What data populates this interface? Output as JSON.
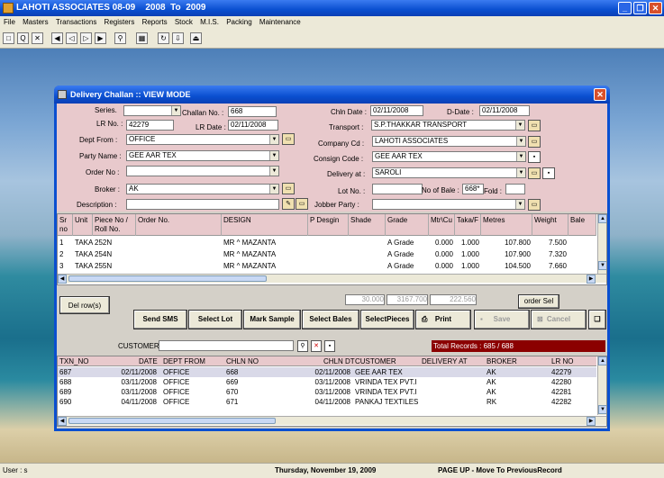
{
  "app": {
    "title": "LAHOTI ASSOCIATES 08-09    2008  To  2009"
  },
  "menu": [
    "File",
    "Masters",
    "Transactions",
    "Registers",
    "Reports",
    "Stock",
    "M.I.S.",
    "Packing",
    "Maintenance"
  ],
  "dialog": {
    "title": "Delivery Challan :: VIEW MODE"
  },
  "form": {
    "series_label": "Series.",
    "series_value": "",
    "challan_no_label": "Challan No. :",
    "challan_no": "668",
    "lr_no_label": "LR No. :",
    "lr_no": "42279",
    "lr_date_label": "LR Date :",
    "lr_date": "02/11/2008",
    "dept_from_label": "Dept From :",
    "dept_from": "OFFICE",
    "party_name_label": "Party Name :",
    "party_name": "GEE AAR TEX",
    "order_no_label": "Order No :",
    "order_no": "",
    "broker_label": "Broker :",
    "broker": "AK",
    "description_label": "Description :",
    "description": "",
    "chln_date_label": "Chln Date :",
    "chln_date": "02/11/2008",
    "d_date_label": "D-Date :",
    "d_date": "02/11/2008",
    "transport_label": "Transport :",
    "transport": "S.P.THAKKAR TRANSPORT",
    "company_cd_label": "Company Cd :",
    "company_cd": "LAHOTI ASSOCIATES",
    "consign_code_label": "Consign Code :",
    "consign_code": "GEE AAR TEX",
    "delivery_at_label": "Delivery at :",
    "delivery_at": "SAROLI",
    "lot_no_label": "Lot No. :",
    "lot_no": "",
    "no_of_bale_label": "No of Bale :",
    "no_of_bale": "668*",
    "fold_label": "Fold :",
    "fold": "",
    "jobber_party_label": "Jobber Party :",
    "jobber_party": ""
  },
  "items": {
    "columns": [
      "Sr no",
      "Unit",
      "Piece No / Roll No.",
      "Order No.",
      "DESIGN",
      "P Desgin",
      "Shade",
      "Grade",
      "Mtr\\Cu",
      "Taka/F",
      "Metres",
      "Weight",
      "Bale"
    ],
    "rows": [
      [
        "1",
        "TAKA",
        "252N",
        "",
        "MR ^ MAZANTA",
        "",
        "",
        "A Grade",
        "0.000",
        "1.000",
        "107.800",
        "7.500",
        ""
      ],
      [
        "2",
        "TAKA",
        "254N",
        "",
        "MR ^ MAZANTA",
        "",
        "",
        "A Grade",
        "0.000",
        "1.000",
        "107.900",
        "7.320",
        ""
      ],
      [
        "3",
        "TAKA",
        "255N",
        "",
        "MR ^ MAZANTA",
        "",
        "",
        "A Grade",
        "0.000",
        "1.000",
        "104.500",
        "7.660",
        ""
      ]
    ]
  },
  "totals": {
    "t1": "30.000",
    "t2": "3167.700",
    "t3": "222.560"
  },
  "buttons": {
    "del_row": "Del row(s)",
    "order_sel": "order Sel",
    "send_sms": "Send SMS",
    "select_lot": "Select Lot",
    "mark_sample": "Mark Sample",
    "select_bales": "Select Bales",
    "select_pieces": "SelectPieces",
    "print": "Print",
    "save": "Save",
    "cancel": "Cancel"
  },
  "search": {
    "customer_label": "CUSTOMER",
    "customer_value": "",
    "total_records": "Total Records : 685 / 688"
  },
  "list": {
    "columns": [
      "TXN_NO",
      "DATE",
      "DEPT FROM",
      "CHLN NO",
      "CHLN DT",
      "CUSTOMER",
      "DELIVERY AT",
      "BROKER",
      "LR NO"
    ],
    "rows": [
      [
        "687",
        "02/11/2008",
        "OFFICE",
        "668",
        "02/11/2008",
        "GEE AAR TEX",
        "",
        "AK",
        "42279"
      ],
      [
        "688",
        "03/11/2008",
        "OFFICE",
        "669",
        "03/11/2008",
        "VRINDA TEX PVT.I",
        "",
        "AK",
        "42280"
      ],
      [
        "689",
        "03/11/2008",
        "OFFICE",
        "670",
        "03/11/2008",
        "VRINDA TEX PVT.I",
        "",
        "AK",
        "42281"
      ],
      [
        "690",
        "04/11/2008",
        "OFFICE",
        "671",
        "04/11/2008",
        "PANKAJ TEXTILES",
        "",
        "RK",
        "42282"
      ]
    ]
  },
  "status": {
    "user": "User : s",
    "date": "Thursday, November 19, 2009",
    "hint": "PAGE UP - Move To PreviousRecord"
  }
}
